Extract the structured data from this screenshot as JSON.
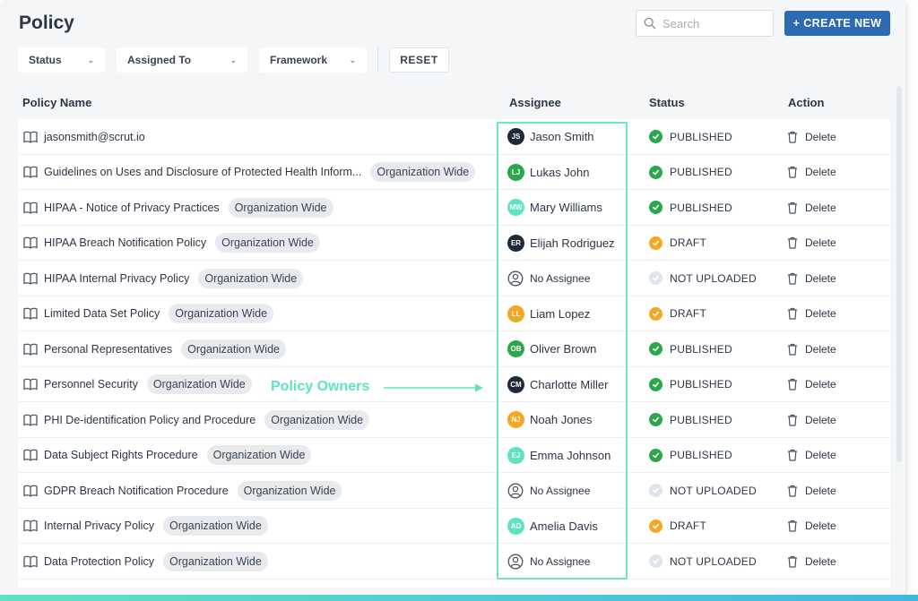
{
  "page": {
    "title": "Policy"
  },
  "search": {
    "placeholder": "Search"
  },
  "toolbar": {
    "create_label": "+ CREATE NEW",
    "reset_label": "RESET"
  },
  "filters": [
    {
      "label": "Status"
    },
    {
      "label": "Assigned To"
    },
    {
      "label": "Framework"
    }
  ],
  "table": {
    "headers": {
      "name": "Policy Name",
      "assignee": "Assignee",
      "status": "Status",
      "action": "Action"
    },
    "action_label": "Delete",
    "rows": [
      {
        "name": "jasonsmith@scrut.io",
        "tag": "",
        "assignee": "Jason Smith",
        "initials": "JS",
        "avatar_color": "#1f2a36",
        "status": "PUBLISHED",
        "status_kind": "published"
      },
      {
        "name": "Guidelines on Uses and Disclosure of Protected Health Inform...",
        "tag": "Organization Wide",
        "assignee": "Lukas John",
        "initials": "LJ",
        "avatar_color": "#2aa74a",
        "status": "PUBLISHED",
        "status_kind": "published"
      },
      {
        "name": "HIPAA - Notice of Privacy Practices",
        "tag": "Organization Wide",
        "assignee": "Mary Williams",
        "initials": "MW",
        "avatar_color": "#5de3c2",
        "status": "PUBLISHED",
        "status_kind": "published"
      },
      {
        "name": "HIPAA Breach Notification Policy",
        "tag": "Organization Wide",
        "assignee": "Elijah Rodriguez",
        "initials": "ER",
        "avatar_color": "#1f2a36",
        "status": "DRAFT",
        "status_kind": "draft"
      },
      {
        "name": "HIPAA Internal Privacy Policy",
        "tag": "Organization Wide",
        "assignee": "No Assignee",
        "initials": "",
        "avatar_color": "",
        "status": "NOT UPLOADED",
        "status_kind": "not-uploaded"
      },
      {
        "name": "Limited Data Set Policy",
        "tag": "Organization Wide",
        "assignee": "Liam Lopez",
        "initials": "LL",
        "avatar_color": "#f5a623",
        "status": "DRAFT",
        "status_kind": "draft"
      },
      {
        "name": "Personal Representatives",
        "tag": "Organization Wide",
        "assignee": "Oliver Brown",
        "initials": "OB",
        "avatar_color": "#2aa74a",
        "status": "PUBLISHED",
        "status_kind": "published"
      },
      {
        "name": "Personnel Security",
        "tag": "Organization Wide",
        "assignee": "Charlotte Miller",
        "initials": "CM",
        "avatar_color": "#1f2a36",
        "status": "PUBLISHED",
        "status_kind": "published"
      },
      {
        "name": "PHI De-identification Policy and Procedure",
        "tag": "Organization Wide",
        "assignee": "Noah Jones",
        "initials": "NJ",
        "avatar_color": "#f5a623",
        "status": "PUBLISHED",
        "status_kind": "published"
      },
      {
        "name": "Data Subject Rights Procedure",
        "tag": "Organization Wide",
        "assignee": "Emma Johnson",
        "initials": "EJ",
        "avatar_color": "#5de3c2",
        "status": "PUBLISHED",
        "status_kind": "published"
      },
      {
        "name": "GDPR Breach Notification Procedure",
        "tag": "Organization Wide",
        "assignee": "No Assignee",
        "initials": "",
        "avatar_color": "",
        "status": "NOT UPLOADED",
        "status_kind": "not-uploaded"
      },
      {
        "name": "Internal Privacy Policy",
        "tag": "Organization Wide",
        "assignee": "Amelia Davis",
        "initials": "AD",
        "avatar_color": "#5de3c2",
        "status": "DRAFT",
        "status_kind": "draft"
      },
      {
        "name": "Data Protection Policy",
        "tag": "Organization Wide",
        "assignee": "No Assignee",
        "initials": "",
        "avatar_color": "",
        "status": "NOT UPLOADED",
        "status_kind": "not-uploaded"
      }
    ]
  },
  "annotation": {
    "label": "Policy Owners"
  },
  "colors": {
    "primary": "#2d6ab1",
    "published": "#2aa74a",
    "draft": "#f5a623",
    "not_uploaded": "#dfe5ec",
    "highlight": "#6ee6c6"
  }
}
